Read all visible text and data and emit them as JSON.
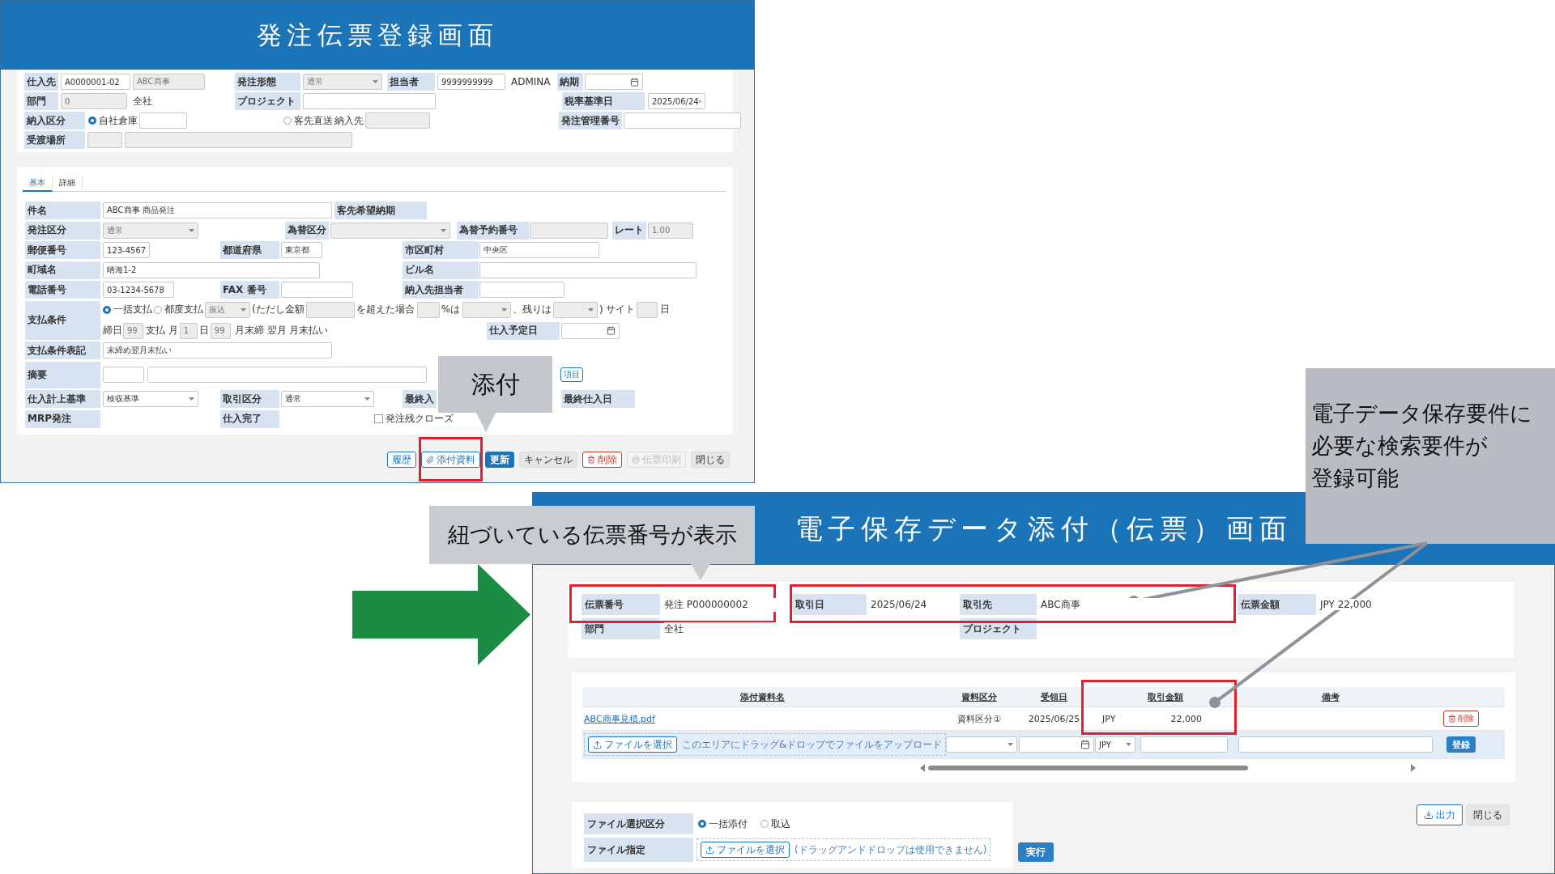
{
  "order_screen": {
    "title": "発注伝票登録画面",
    "header_rows": [
      [
        {
          "kind": "label",
          "text": "仕入先"
        },
        {
          "kind": "input",
          "value": "A0000001-02",
          "disabled": false
        },
        {
          "kind": "input",
          "value": "ABC商事",
          "disabled": true
        },
        {
          "kind": "label",
          "text": "発注形態"
        },
        {
          "kind": "select",
          "value": "通常",
          "disabled": true
        },
        {
          "kind": "label",
          "text": "担当者"
        },
        {
          "kind": "input",
          "value": "9999999999",
          "disabled": false
        },
        {
          "kind": "text",
          "text": "ADMINA"
        },
        {
          "kind": "label",
          "text": "納期"
        },
        {
          "kind": "date"
        }
      ],
      [
        {
          "kind": "label",
          "text": "部門"
        },
        {
          "kind": "input",
          "value": "0",
          "disabled": true
        },
        {
          "kind": "text",
          "text": "全社"
        },
        {
          "kind": "label",
          "text": "プロジェクト"
        },
        {
          "kind": "input",
          "disabled": false
        },
        {
          "kind": "label",
          "text": "税率基準日"
        },
        {
          "kind": "date",
          "value": "2025/06/24"
        }
      ],
      [
        {
          "kind": "label",
          "text": "納入区分"
        },
        {
          "kind": "radio",
          "label": "自社倉庫",
          "selected": true
        },
        {
          "kind": "input",
          "disabled": false
        },
        {
          "kind": "radio",
          "label": "客先直送",
          "selected": false
        },
        {
          "kind": "text",
          "text": "納入先"
        },
        {
          "kind": "input",
          "disabled": true
        },
        {
          "kind": "label",
          "text": "発注管理番号"
        },
        {
          "kind": "input",
          "disabled": false
        }
      ],
      [
        {
          "kind": "label",
          "text": "受渡場所"
        },
        {
          "kind": "input",
          "disabled": true
        },
        {
          "kind": "input",
          "disabled": true
        }
      ]
    ],
    "tabs": [
      {
        "label": "基本",
        "selected": true
      },
      {
        "label": "詳細",
        "selected": false
      }
    ],
    "detail_rows": [
      [
        {
          "kind": "label",
          "text": "件名"
        },
        {
          "kind": "input",
          "value": "ABC商事  商品発注",
          "disabled": false
        },
        {
          "kind": "label",
          "text": "客先希望納期"
        }
      ],
      [
        {
          "kind": "label",
          "text": "発注区分"
        },
        {
          "kind": "select",
          "value": "通常",
          "disabled": true
        },
        {
          "kind": "label",
          "text": "為替区分"
        },
        {
          "kind": "select",
          "disabled": true
        },
        {
          "kind": "label",
          "text": "為替予約番号"
        },
        {
          "kind": "input",
          "disabled": true
        },
        {
          "kind": "label",
          "text": "レート"
        },
        {
          "kind": "input",
          "value": "1.00",
          "disabled": true
        }
      ],
      [
        {
          "kind": "label",
          "text": "郵便番号"
        },
        {
          "kind": "input",
          "value": "123-4567",
          "disabled": false
        },
        {
          "kind": "label",
          "text": "都道府県"
        },
        {
          "kind": "input",
          "value": "東京都",
          "disabled": false
        },
        {
          "kind": "label",
          "text": "市区町村"
        },
        {
          "kind": "input",
          "value": "中央区",
          "disabled": false
        }
      ],
      [
        {
          "kind": "label",
          "text": "町域名"
        },
        {
          "kind": "input",
          "value": "晴海1-2",
          "disabled": false
        },
        {
          "kind": "label",
          "text": "ビル名"
        },
        {
          "kind": "input",
          "disabled": false
        }
      ],
      [
        {
          "kind": "label",
          "text": "電話番号"
        },
        {
          "kind": "input",
          "value": "03-1234-5678",
          "disabled": false
        },
        {
          "kind": "label",
          "text": "FAX 番号"
        },
        {
          "kind": "input",
          "disabled": false
        },
        {
          "kind": "label",
          "text": "納入先担当者"
        },
        {
          "kind": "input",
          "disabled": false
        }
      ],
      [
        {
          "kind": "label",
          "text": "支払条件"
        },
        {
          "kind": "group",
          "lines": [
            [
              {
                "kind": "radio",
                "label": "一括支払",
                "selected": true
              },
              {
                "kind": "radio",
                "label": "都度支払",
                "selected": false
              },
              {
                "kind": "select",
                "value": "振込",
                "disabled": true
              },
              {
                "kind": "text",
                "text": "(ただし金額"
              },
              {
                "kind": "input",
                "disabled": true
              },
              {
                "kind": "text",
                "text": "を超えた場合"
              },
              {
                "kind": "input",
                "disabled": true
              },
              {
                "kind": "text",
                "text": "%は"
              },
              {
                "kind": "select",
                "disabled": true
              },
              {
                "kind": "text",
                "text": "、残りは"
              },
              {
                "kind": "select",
                "disabled": true
              },
              {
                "kind": "text",
                "text": ")"
              },
              {
                "kind": "text",
                "text": "サイト"
              },
              {
                "kind": "input",
                "disabled": true
              },
              {
                "kind": "text",
                "text": "日"
              }
            ],
            [
              {
                "kind": "text",
                "text": "締日"
              },
              {
                "kind": "input",
                "value": "99",
                "disabled": true
              },
              {
                "kind": "text",
                "text": "支払 月"
              },
              {
                "kind": "input",
                "value": "1",
                "disabled": true
              },
              {
                "kind": "text",
                "text": "日"
              },
              {
                "kind": "input",
                "value": "99",
                "disabled": true
              },
              {
                "kind": "text",
                "text": "月末締 翌月 月末払い"
              },
              {
                "kind": "label",
                "text": "仕入予定日"
              },
              {
                "kind": "date"
              }
            ]
          ]
        }
      ],
      [
        {
          "kind": "label",
          "text": "支払条件表記"
        },
        {
          "kind": "input",
          "value": "末締め翌月末払い",
          "disabled": false
        }
      ],
      [
        {
          "kind": "label",
          "text": "摘要"
        },
        {
          "kind": "input",
          "disabled": false
        },
        {
          "kind": "input",
          "disabled": false
        },
        {
          "kind": "button",
          "label": "項目"
        }
      ],
      [
        {
          "kind": "label",
          "text": "仕入計上基準"
        },
        {
          "kind": "select",
          "value": "検収基準",
          "disabled": false
        },
        {
          "kind": "label",
          "text": "取引区分"
        },
        {
          "kind": "select",
          "value": "通常",
          "disabled": false
        },
        {
          "kind": "label",
          "text": "最終入"
        },
        {
          "kind": "label",
          "text": "最終仕入日"
        }
      ],
      [
        {
          "kind": "label",
          "text": "MRP発注"
        },
        {
          "kind": "label",
          "text": "仕入完了"
        },
        {
          "kind": "checkbox",
          "label": "発注残クローズ",
          "checked": false
        }
      ]
    ],
    "buttons": [
      {
        "label": "履歴",
        "kind": "history"
      },
      {
        "label": "添付資料",
        "kind": "attach"
      },
      {
        "label": "更新",
        "kind": "update"
      },
      {
        "label": "キャンセル",
        "kind": "cancel"
      },
      {
        "label": "削除",
        "kind": "delete"
      },
      {
        "label": "伝票印刷",
        "kind": "print"
      },
      {
        "label": "閉じる",
        "kind": "close"
      }
    ]
  },
  "attach_callout": {
    "text": "添付"
  },
  "ref_callout": {
    "text": "紐づいている伝票番号が表示"
  },
  "search_callout": {
    "lines": [
      "電子データ保存要件に",
      "必要な検索要件が",
      "登録可能"
    ]
  },
  "attach_screen": {
    "title": "電子保存データ添付（伝票）画面",
    "info_rows": [
      [
        {
          "kind": "label",
          "text": "伝票番号"
        },
        {
          "kind": "text",
          "text": "発注 P000000002"
        },
        {
          "kind": "label",
          "text": "取引日"
        },
        {
          "kind": "text",
          "text": "2025/06/24"
        },
        {
          "kind": "label",
          "text": "取引先"
        },
        {
          "kind": "text",
          "text": "ABC商事"
        },
        {
          "kind": "label",
          "text": "伝票金額"
        },
        {
          "kind": "text",
          "text": "JPY 22,000"
        }
      ],
      [
        {
          "kind": "label",
          "text": "部門"
        },
        {
          "kind": "text",
          "text": "全社"
        },
        {
          "kind": "label",
          "text": "プロジェクト"
        }
      ]
    ],
    "table": {
      "columns": [
        "添付資料名",
        "資料区分",
        "受領日",
        "取引金額",
        "備考"
      ],
      "rows": [
        {
          "file": "ABC商事見積.pdf",
          "type": "資料区分①",
          "received": "2025/06/25",
          "currency": "JPY",
          "amount": "22,000",
          "delete_label": "削除"
        }
      ],
      "upload": {
        "file_button": "ファイルを選択",
        "drop_hint": "このエリアにドラッグ&ドロップでファイルをアップロード",
        "currency": "JPY",
        "register_label": "登録"
      }
    },
    "file_options": {
      "mode_label": "ファイル選択区分",
      "modes": [
        {
          "label": "一括添付",
          "selected": true
        },
        {
          "label": "取込",
          "selected": false
        }
      ],
      "file_label": "ファイル指定",
      "file_button": "ファイルを選択",
      "hint": "(ドラッグアンドドロップは使用できません)"
    },
    "run_label": "実行",
    "buttons": [
      {
        "label": "出力",
        "kind": "export"
      },
      {
        "label": "閉じる",
        "kind": "close"
      }
    ]
  }
}
